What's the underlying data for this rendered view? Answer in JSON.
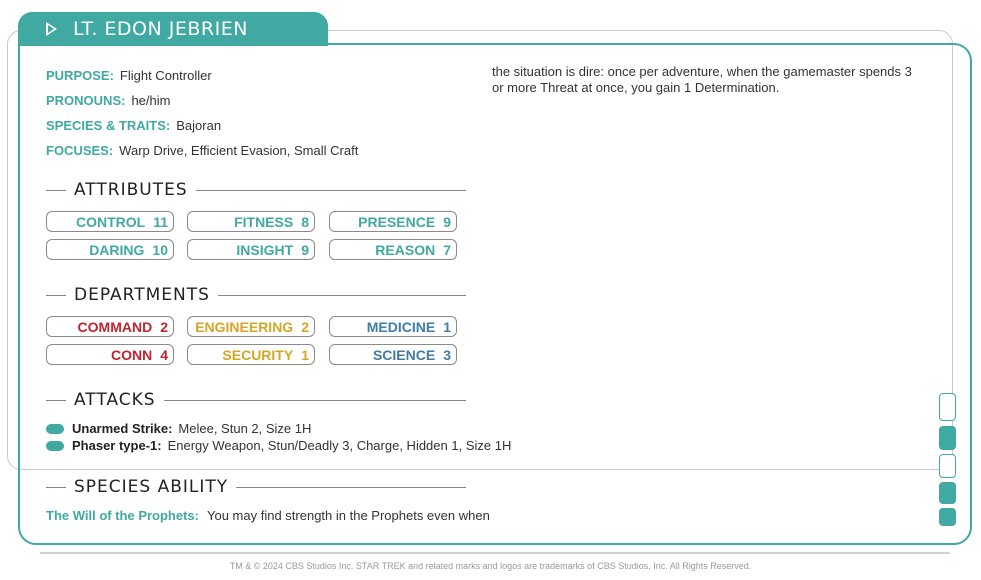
{
  "character": {
    "title": "LT. EDON JEBRIEN"
  },
  "info": {
    "purpose_label": "PURPOSE:",
    "purpose": "Flight Controller",
    "pronouns_label": "PRONOUNS:",
    "pronouns": "he/him",
    "species_label": "SPECIES & TRAITS:",
    "species": "Bajoran",
    "focuses_label": "FOCUSES:",
    "focuses": "Warp Drive, Efficient Evasion, Small Craft"
  },
  "sections": {
    "attributes": "ATTRIBUTES",
    "departments": "DEPARTMENTS",
    "attacks": "ATTACKS",
    "species_ability": "SPECIES ABILITY"
  },
  "attributes": [
    {
      "name": "CONTROL",
      "value": "11"
    },
    {
      "name": "FITNESS",
      "value": "8"
    },
    {
      "name": "PRESENCE",
      "value": "9"
    },
    {
      "name": "DARING",
      "value": "10"
    },
    {
      "name": "INSIGHT",
      "value": "9"
    },
    {
      "name": "REASON",
      "value": "7"
    }
  ],
  "departments": [
    {
      "name": "COMMAND",
      "value": "2",
      "color": "#c0242e"
    },
    {
      "name": "ENGINEERING",
      "value": "2",
      "color": "#d4a624"
    },
    {
      "name": "MEDICINE",
      "value": "1",
      "color": "#3f7ca8"
    },
    {
      "name": "CONN",
      "value": "4",
      "color": "#c0242e"
    },
    {
      "name": "SECURITY",
      "value": "1",
      "color": "#d4a624"
    },
    {
      "name": "SCIENCE",
      "value": "3",
      "color": "#3f7ca8"
    }
  ],
  "attacks": [
    {
      "name": "Unarmed Strike:",
      "desc": "Melee, Stun 2, Size 1H"
    },
    {
      "name": "Phaser type-1:",
      "desc": "Energy Weapon, Stun/Deadly 3, Charge, Hidden 1, Size 1H"
    }
  ],
  "species_ability": {
    "name": "The Will of the Prophets:",
    "text": "You may find strength in the Prophets even when"
  },
  "right_column": {
    "text": "the situation is dire: once per adventure, when the gamemaster spends 3 or more Threat at once, you gain 1 Determination."
  },
  "footer": "TM & © 2024 CBS Studios Inc. STAR TREK and related marks and logos are trademarks of CBS Studios, Inc. All Rights Reserved.",
  "colors": {
    "accent": "#3fa9a2",
    "command": "#c0242e",
    "operations": "#d4a624",
    "sciences": "#3f7ca8"
  }
}
